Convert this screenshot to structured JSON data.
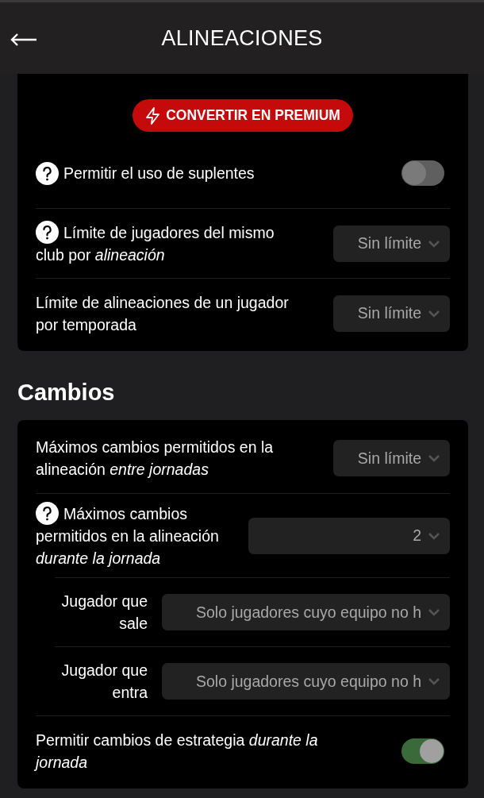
{
  "header": {
    "title": "ALINEACIONES"
  },
  "sections": [
    {
      "premium_button": "CONVERTIR EN PREMIUM",
      "rows": [
        {
          "kind": "toggle",
          "help": true,
          "label": "Permitir el uso de suplentes",
          "on": false
        },
        {
          "kind": "select",
          "help": true,
          "label": "Límite de jugadores del mismo",
          "label_continued": "club por *alineación*",
          "value": "Sin límite"
        },
        {
          "kind": "select",
          "help": false,
          "label": "Límite de alineaciones de un jugador por temporada",
          "value": "Sin límite"
        }
      ]
    },
    {
      "title": "Cambios",
      "rows": [
        {
          "kind": "select",
          "help": false,
          "label": "Máximos cambios permitidos en la alineación *entre jornadas*",
          "value": "Sin límite"
        },
        {
          "kind": "select_wide",
          "help": true,
          "label": "Máximos cambios",
          "label_continued": "permitidos en la alineación *durante la jornada*",
          "value": "2"
        },
        {
          "kind": "sub_select",
          "help": false,
          "label": "Jugador que sale",
          "value": "Solo jugadores cuyo equipo no h"
        },
        {
          "kind": "sub_select",
          "help": false,
          "label": "Jugador que entra",
          "value": "Solo jugadores cuyo equipo no h"
        },
        {
          "kind": "toggle",
          "help": false,
          "label": "Permitir cambios de estrategia *durante la jornada*",
          "on": true
        }
      ]
    }
  ]
}
